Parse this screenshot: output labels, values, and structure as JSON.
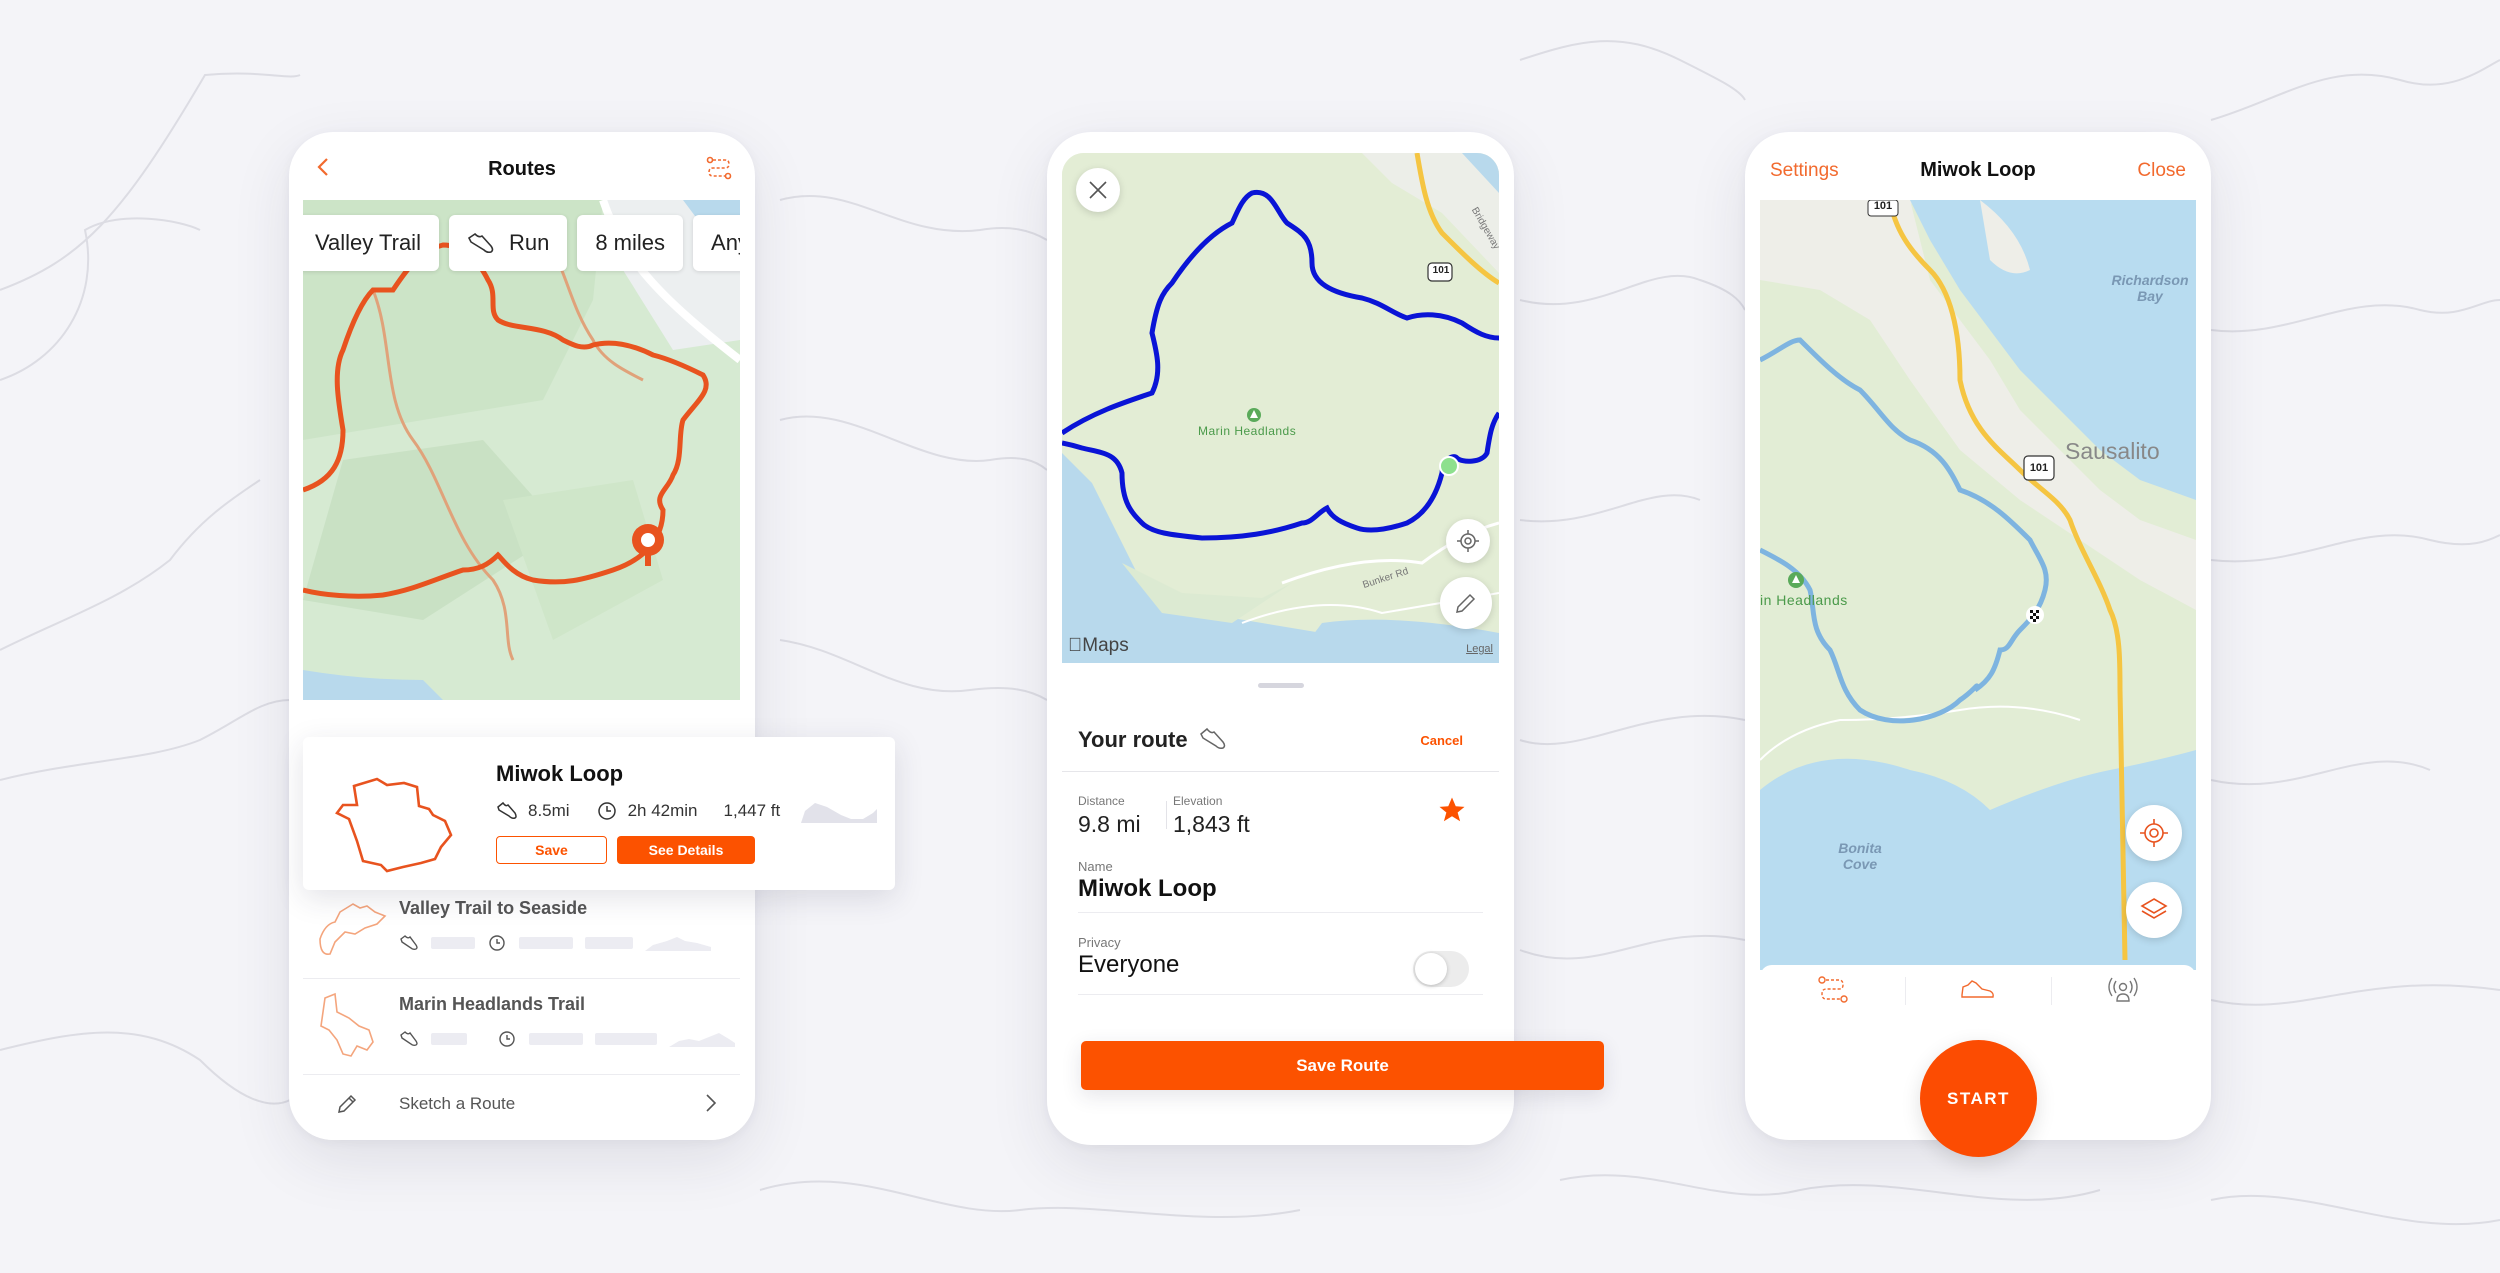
{
  "colors": {
    "accent": "#fc5200",
    "accent_text": "#f26a2e",
    "route_orange": "#e8531f",
    "route_blue": "#0a14d6",
    "route_light_blue": "#7eb4e0",
    "background": "#f4f4f8"
  },
  "routes_screen": {
    "title": "Routes",
    "back_icon": "chevron-left-icon",
    "routes_icon": "route-dashed-icon",
    "filter_chips": [
      {
        "label": "Valley Trail",
        "icon": null
      },
      {
        "label": "Run",
        "icon": "shoe-icon"
      },
      {
        "label": "8 miles",
        "icon": null
      },
      {
        "label": "Any E",
        "icon": null
      }
    ],
    "featured_route": {
      "name": "Miwok Loop",
      "distance": "8.5mi",
      "duration": "2h 42min",
      "elevation": "1,447 ft",
      "save_label": "Save",
      "details_label": "See Details"
    },
    "route_list": [
      {
        "name": "Valley Trail to Seaside"
      },
      {
        "name": "Marin Headlands Trail"
      }
    ],
    "sketch_label": "Sketch a Route"
  },
  "create_screen": {
    "map_labels": {
      "park": "Marin Headlands",
      "highway": "101",
      "street_1": "Bridgeway",
      "street_2": "Bunker Rd",
      "maps_logo": "Maps",
      "legal": "Legal"
    },
    "sheet": {
      "title": "Your route",
      "cancel_label": "Cancel",
      "distance_label": "Distance",
      "distance_value": "9.8 mi",
      "elevation_label": "Elevation",
      "elevation_value": "1,843 ft",
      "favorited": true,
      "name_label": "Name",
      "name_value": "Miwok Loop",
      "privacy_label": "Privacy",
      "privacy_value": "Everyone",
      "privacy_toggle_on": false
    },
    "save_button": "Save Route"
  },
  "navigate_screen": {
    "settings_label": "Settings",
    "title": "Miwok Loop",
    "close_label": "Close",
    "map_labels": {
      "bay": "Richardson Bay",
      "city": "Sausalito",
      "highway_top": "101",
      "highway": "101",
      "park": "in Headlands",
      "cove": "Bonita Cove"
    },
    "tabs": [
      {
        "icon": "route-dashed-icon"
      },
      {
        "icon": "shoe-icon"
      },
      {
        "icon": "beacon-icon"
      }
    ],
    "start_label": "START"
  }
}
